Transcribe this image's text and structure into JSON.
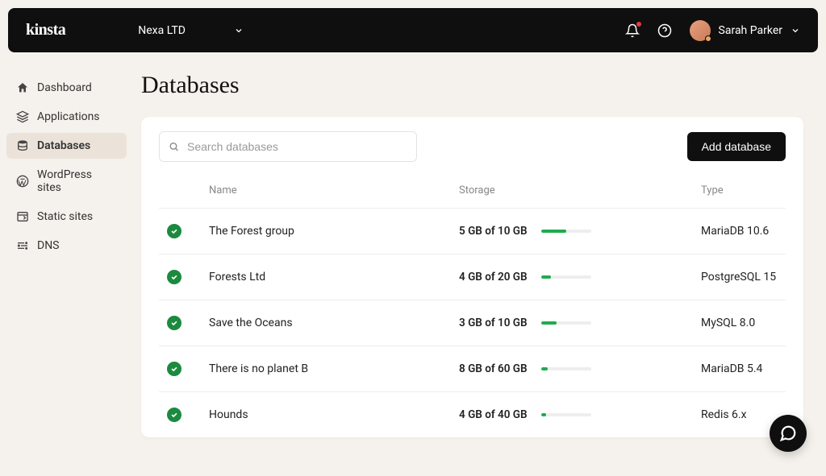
{
  "header": {
    "logo": "kinsta",
    "company": "Nexa LTD",
    "user_name": "Sarah Parker"
  },
  "sidebar": {
    "items": [
      {
        "label": "Dashboard",
        "icon": "home"
      },
      {
        "label": "Applications",
        "icon": "layers"
      },
      {
        "label": "Databases",
        "icon": "database",
        "active": true
      },
      {
        "label": "WordPress sites",
        "icon": "wordpress"
      },
      {
        "label": "Static sites",
        "icon": "browser"
      },
      {
        "label": "DNS",
        "icon": "dns"
      }
    ]
  },
  "page": {
    "title": "Databases",
    "search_placeholder": "Search databases",
    "add_button": "Add database",
    "columns": {
      "name": "Name",
      "storage": "Storage",
      "type": "Type"
    },
    "rows": [
      {
        "name": "The Forest group",
        "storage_text": "5 GB of 10 GB",
        "fill": 50,
        "type": "MariaDB 10.6"
      },
      {
        "name": "Forests Ltd",
        "storage_text": "4 GB of 20 GB",
        "fill": 20,
        "type": "PostgreSQL 15"
      },
      {
        "name": "Save the Oceans",
        "storage_text": "3 GB of 10 GB",
        "fill": 30,
        "type": "MySQL 8.0"
      },
      {
        "name": "There is no planet B",
        "storage_text": "8 GB of 60 GB",
        "fill": 13,
        "type": "MariaDB 5.4"
      },
      {
        "name": "Hounds",
        "storage_text": "4 GB of 40 GB",
        "fill": 10,
        "type": "Redis 6.x"
      }
    ]
  }
}
